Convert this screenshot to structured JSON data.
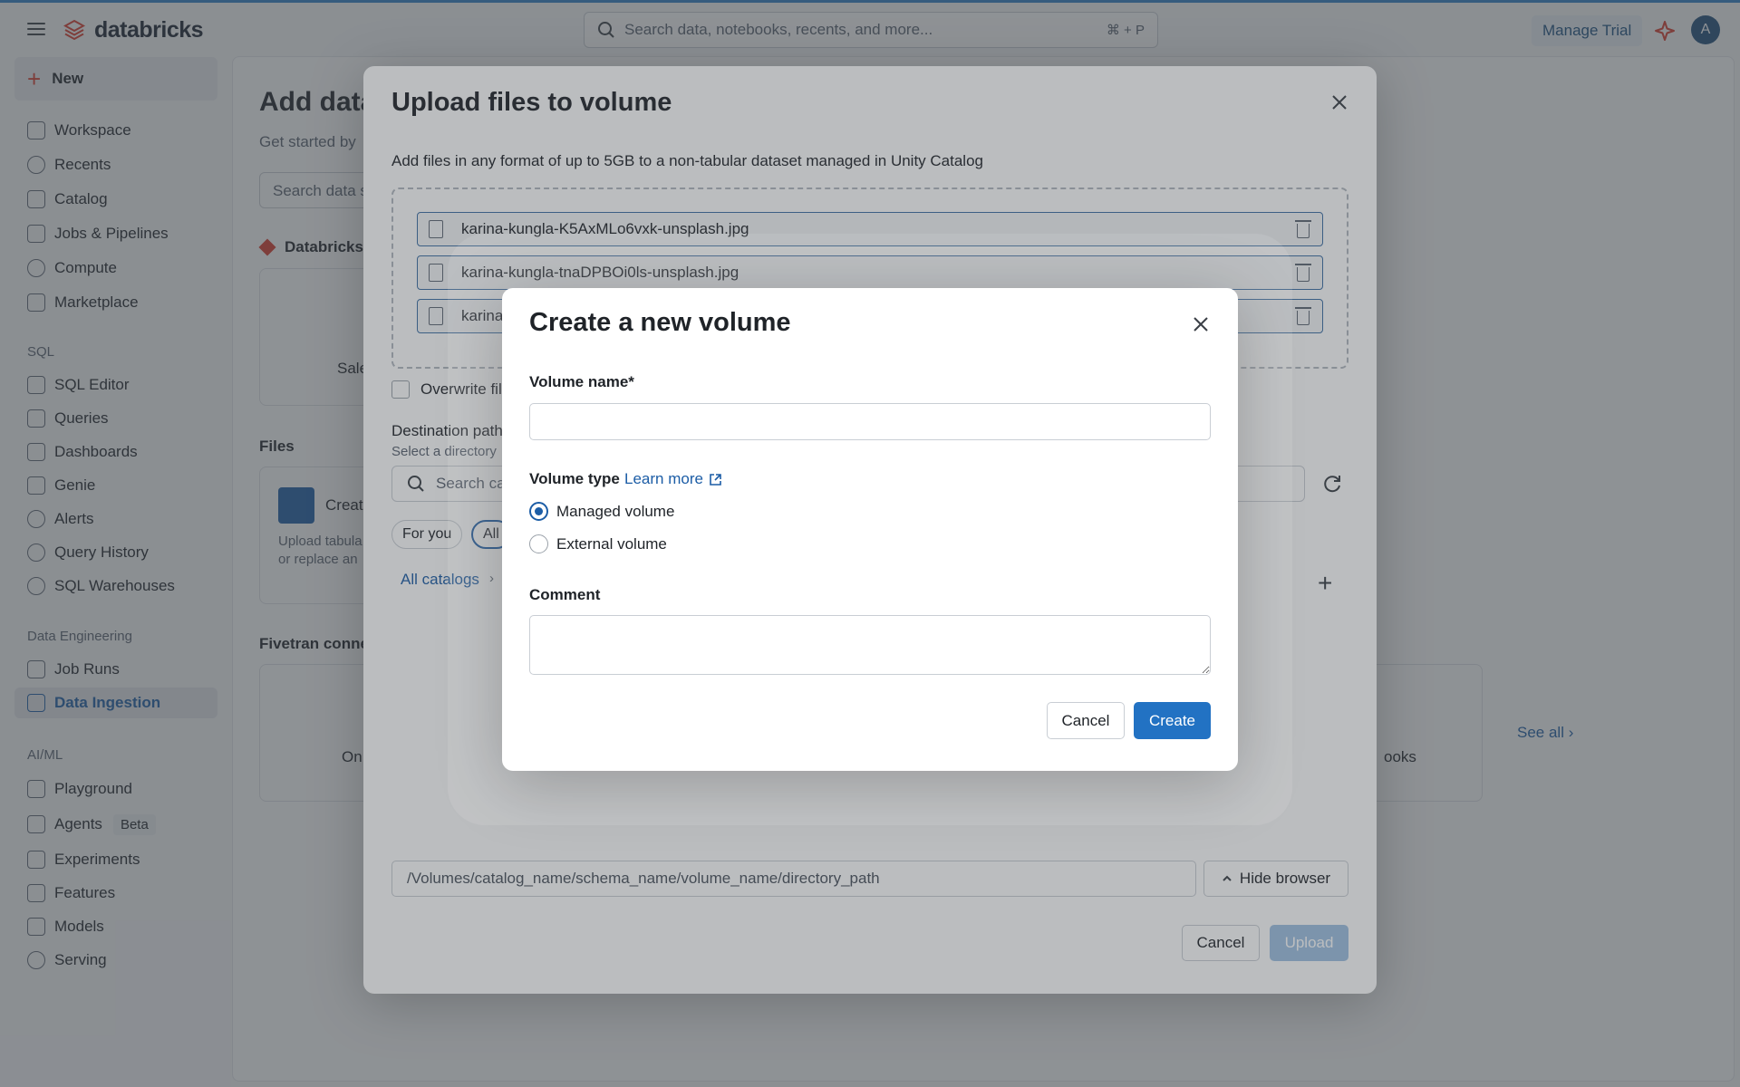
{
  "topbar": {
    "brand": "databricks",
    "search_placeholder": "Search data, notebooks, recents, and more...",
    "search_shortcut": "⌘ + P",
    "manage_trial": "Manage Trial",
    "avatar_initial": "A"
  },
  "sidebar": {
    "new_label": "New",
    "items": [
      {
        "label": "Workspace"
      },
      {
        "label": "Recents"
      },
      {
        "label": "Catalog"
      },
      {
        "label": "Jobs & Pipelines"
      },
      {
        "label": "Compute"
      },
      {
        "label": "Marketplace"
      }
    ],
    "sql_label": "SQL",
    "sql_items": [
      {
        "label": "SQL Editor"
      },
      {
        "label": "Queries"
      },
      {
        "label": "Dashboards"
      },
      {
        "label": "Genie"
      },
      {
        "label": "Alerts"
      },
      {
        "label": "Query History"
      },
      {
        "label": "SQL Warehouses"
      }
    ],
    "de_label": "Data Engineering",
    "de_items": [
      {
        "label": "Job Runs"
      },
      {
        "label": "Data Ingestion",
        "active": true
      }
    ],
    "ml_label": "AI/ML",
    "ml_items": [
      {
        "label": "Playground"
      },
      {
        "label": "Agents",
        "badge": "Beta"
      },
      {
        "label": "Experiments"
      },
      {
        "label": "Features"
      },
      {
        "label": "Models"
      },
      {
        "label": "Serving"
      }
    ]
  },
  "background": {
    "title": "Add data",
    "subtitle": "Get started by",
    "search": "Search data s",
    "databricks_section": "Databricks",
    "card_sales": "Sale",
    "files_section": "Files",
    "create_card_title": "Creat",
    "create_card_desc_1": "Upload tabula",
    "create_card_desc_2": "or replace an",
    "fivetran_section": "Fivetran conne",
    "card_one": "On",
    "card_books": "ooks",
    "see_all": "See all"
  },
  "upload_modal": {
    "title": "Upload files to volume",
    "description": "Add files in any format of up to 5GB to a non-tabular dataset managed in Unity Catalog",
    "files": [
      {
        "name": "karina-kungla-K5AxMLo6vxk-unsplash.jpg"
      },
      {
        "name": "karina-kungla-tnaDPBOi0ls-unsplash.jpg"
      },
      {
        "name": "karina"
      }
    ],
    "overwrite_label": "Overwrite fil",
    "destination_label": "Destination path",
    "destination_sub": "Select a directory",
    "catalog_search_placeholder": "Search ca",
    "tabs": [
      "For you",
      "All"
    ],
    "breadcrumb": "All catalogs",
    "path_placeholder": "/Volumes/catalog_name/schema_name/volume_name/directory_path",
    "hide_browser": "Hide browser",
    "cancel": "Cancel",
    "upload": "Upload"
  },
  "volume_modal": {
    "title": "Create a new volume",
    "name_label": "Volume name*",
    "type_label": "Volume type",
    "learn_more": "Learn more",
    "options": [
      {
        "label": "Managed volume",
        "selected": true
      },
      {
        "label": "External volume",
        "selected": false
      }
    ],
    "comment_label": "Comment",
    "cancel": "Cancel",
    "create": "Create"
  },
  "colors": {
    "accent": "#2272c3",
    "brand_red": "#d83a2b",
    "link": "#1c5da6"
  }
}
